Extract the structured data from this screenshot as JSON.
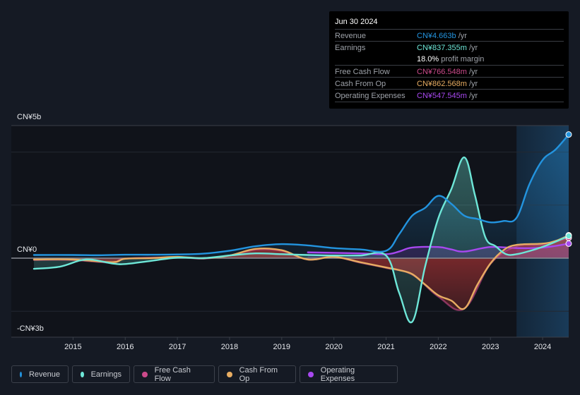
{
  "tooltip": {
    "date": "Jun 30 2024",
    "rows": [
      {
        "label": "Revenue",
        "value": "CN¥4.663b",
        "unit": " /yr",
        "color": "#2394df"
      },
      {
        "label": "Earnings",
        "value": "CN¥837.355m",
        "unit": " /yr",
        "color": "#6ee7d8"
      },
      {
        "label": "",
        "value": "18.0%",
        "unit": " profit margin",
        "color": "#ffffff"
      },
      {
        "label": "Free Cash Flow",
        "value": "CN¥766.548m",
        "unit": " /yr",
        "color": "#cc4a8b"
      },
      {
        "label": "Cash From Op",
        "value": "CN¥862.568m",
        "unit": " /yr",
        "color": "#e8ad62"
      },
      {
        "label": "Operating Expenses",
        "value": "CN¥547.545m",
        "unit": " /yr",
        "color": "#a848f0"
      }
    ]
  },
  "legend": [
    {
      "label": "Revenue",
      "color": "#2394df"
    },
    {
      "label": "Earnings",
      "color": "#6ee7d8"
    },
    {
      "label": "Free Cash Flow",
      "color": "#cc4a8b"
    },
    {
      "label": "Cash From Op",
      "color": "#e8ad62"
    },
    {
      "label": "Operating Expenses",
      "color": "#a848f0"
    }
  ],
  "chart_data": {
    "type": "line",
    "title": "",
    "xlabel": "",
    "ylabel": "",
    "unit": "CN¥ billions",
    "xlim": [
      2014.25,
      2024.5
    ],
    "ylim": [
      -3,
      5
    ],
    "y_tick_labels": [
      {
        "value": 5,
        "label": "CN¥5b"
      },
      {
        "value": 0,
        "label": "CN¥0"
      },
      {
        "value": -3,
        "label": "-CN¥3b"
      }
    ],
    "gridlines": [
      5,
      4,
      2,
      0,
      -2
    ],
    "x_ticks": [
      2015,
      2016,
      2017,
      2018,
      2019,
      2020,
      2021,
      2022,
      2023,
      2024
    ],
    "x_tick_labels": [
      "2015",
      "2016",
      "2017",
      "2018",
      "2019",
      "2020",
      "2021",
      "2022",
      "2023",
      "2024"
    ],
    "highlight_start": 2023.5,
    "series": [
      {
        "name": "Revenue",
        "color": "#2394df",
        "x": [
          2014.25,
          2015.0,
          2015.5,
          2016.0,
          2016.5,
          2017.0,
          2017.5,
          2018.0,
          2018.5,
          2019.0,
          2019.5,
          2020.0,
          2020.5,
          2021.0,
          2021.25,
          2021.5,
          2021.75,
          2022.0,
          2022.25,
          2022.5,
          2022.75,
          2023.0,
          2023.25,
          2023.5,
          2023.75,
          2024.0,
          2024.25,
          2024.5
        ],
        "values": [
          0.12,
          0.12,
          0.11,
          0.13,
          0.13,
          0.14,
          0.17,
          0.28,
          0.45,
          0.53,
          0.48,
          0.38,
          0.33,
          0.28,
          0.9,
          1.6,
          1.9,
          2.35,
          2.05,
          1.6,
          1.48,
          1.35,
          1.4,
          1.52,
          2.8,
          3.7,
          4.1,
          4.663
        ]
      },
      {
        "name": "Earnings",
        "color": "#6ee7d8",
        "x": [
          2014.25,
          2014.75,
          2015.25,
          2015.75,
          2016.0,
          2016.5,
          2017.0,
          2017.5,
          2018.0,
          2018.5,
          2019.0,
          2019.5,
          2020.0,
          2020.5,
          2021.0,
          2021.25,
          2021.5,
          2021.75,
          2022.0,
          2022.25,
          2022.5,
          2022.7,
          2022.9,
          2023.1,
          2023.3,
          2023.5,
          2023.8,
          2024.1,
          2024.5
        ],
        "values": [
          -0.4,
          -0.32,
          -0.05,
          -0.2,
          -0.22,
          -0.1,
          0.02,
          0.0,
          0.1,
          0.18,
          0.15,
          0.12,
          0.1,
          0.1,
          0.1,
          -1.3,
          -2.4,
          -0.3,
          1.5,
          2.6,
          3.8,
          2.4,
          0.8,
          0.45,
          0.15,
          0.15,
          0.3,
          0.5,
          0.837
        ]
      },
      {
        "name": "Free Cash Flow",
        "color": "#cc4a8b",
        "x": [
          2014.25,
          2015.0,
          2015.75,
          2016.0,
          2017.0,
          2017.5,
          2018.0,
          2018.5,
          2019.0,
          2019.5,
          2020.0,
          2020.5,
          2021.0,
          2021.5,
          2022.0,
          2022.5,
          2023.0,
          2023.5,
          2024.0,
          2024.5
        ],
        "values": [
          -0.07,
          -0.07,
          -0.17,
          -0.02,
          0.03,
          -0.02,
          0.1,
          0.32,
          0.28,
          -0.05,
          0.05,
          -0.17,
          -0.37,
          -0.62,
          -1.45,
          -1.9,
          -0.22,
          0.45,
          0.5,
          0.767
        ]
      },
      {
        "name": "Cash From Op",
        "color": "#e8ad62",
        "x": [
          2014.25,
          2015.0,
          2015.75,
          2016.0,
          2016.5,
          2017.0,
          2017.5,
          2018.0,
          2018.5,
          2019.0,
          2019.5,
          2020.0,
          2020.5,
          2021.0,
          2021.25,
          2021.5,
          2021.75,
          2022.0,
          2022.25,
          2022.5,
          2022.75,
          2023.0,
          2023.25,
          2023.5,
          2024.0,
          2024.25,
          2024.5
        ],
        "values": [
          -0.05,
          -0.05,
          -0.15,
          -0.02,
          0.0,
          0.05,
          0.0,
          0.1,
          0.35,
          0.3,
          -0.05,
          0.05,
          -0.15,
          -0.35,
          -0.45,
          -0.6,
          -1.0,
          -1.4,
          -1.6,
          -1.9,
          -1.0,
          -0.2,
          0.3,
          0.5,
          0.55,
          0.65,
          0.863
        ]
      },
      {
        "name": "Operating Expenses",
        "color": "#a848f0",
        "x": [
          2019.5,
          2020.0,
          2020.5,
          2021.0,
          2021.25,
          2021.5,
          2022.0,
          2022.25,
          2022.5,
          2023.0,
          2023.5,
          2024.0,
          2024.5
        ],
        "values": [
          0.22,
          0.2,
          0.18,
          0.15,
          0.25,
          0.4,
          0.42,
          0.33,
          0.25,
          0.42,
          0.38,
          0.4,
          0.548
        ]
      }
    ]
  }
}
